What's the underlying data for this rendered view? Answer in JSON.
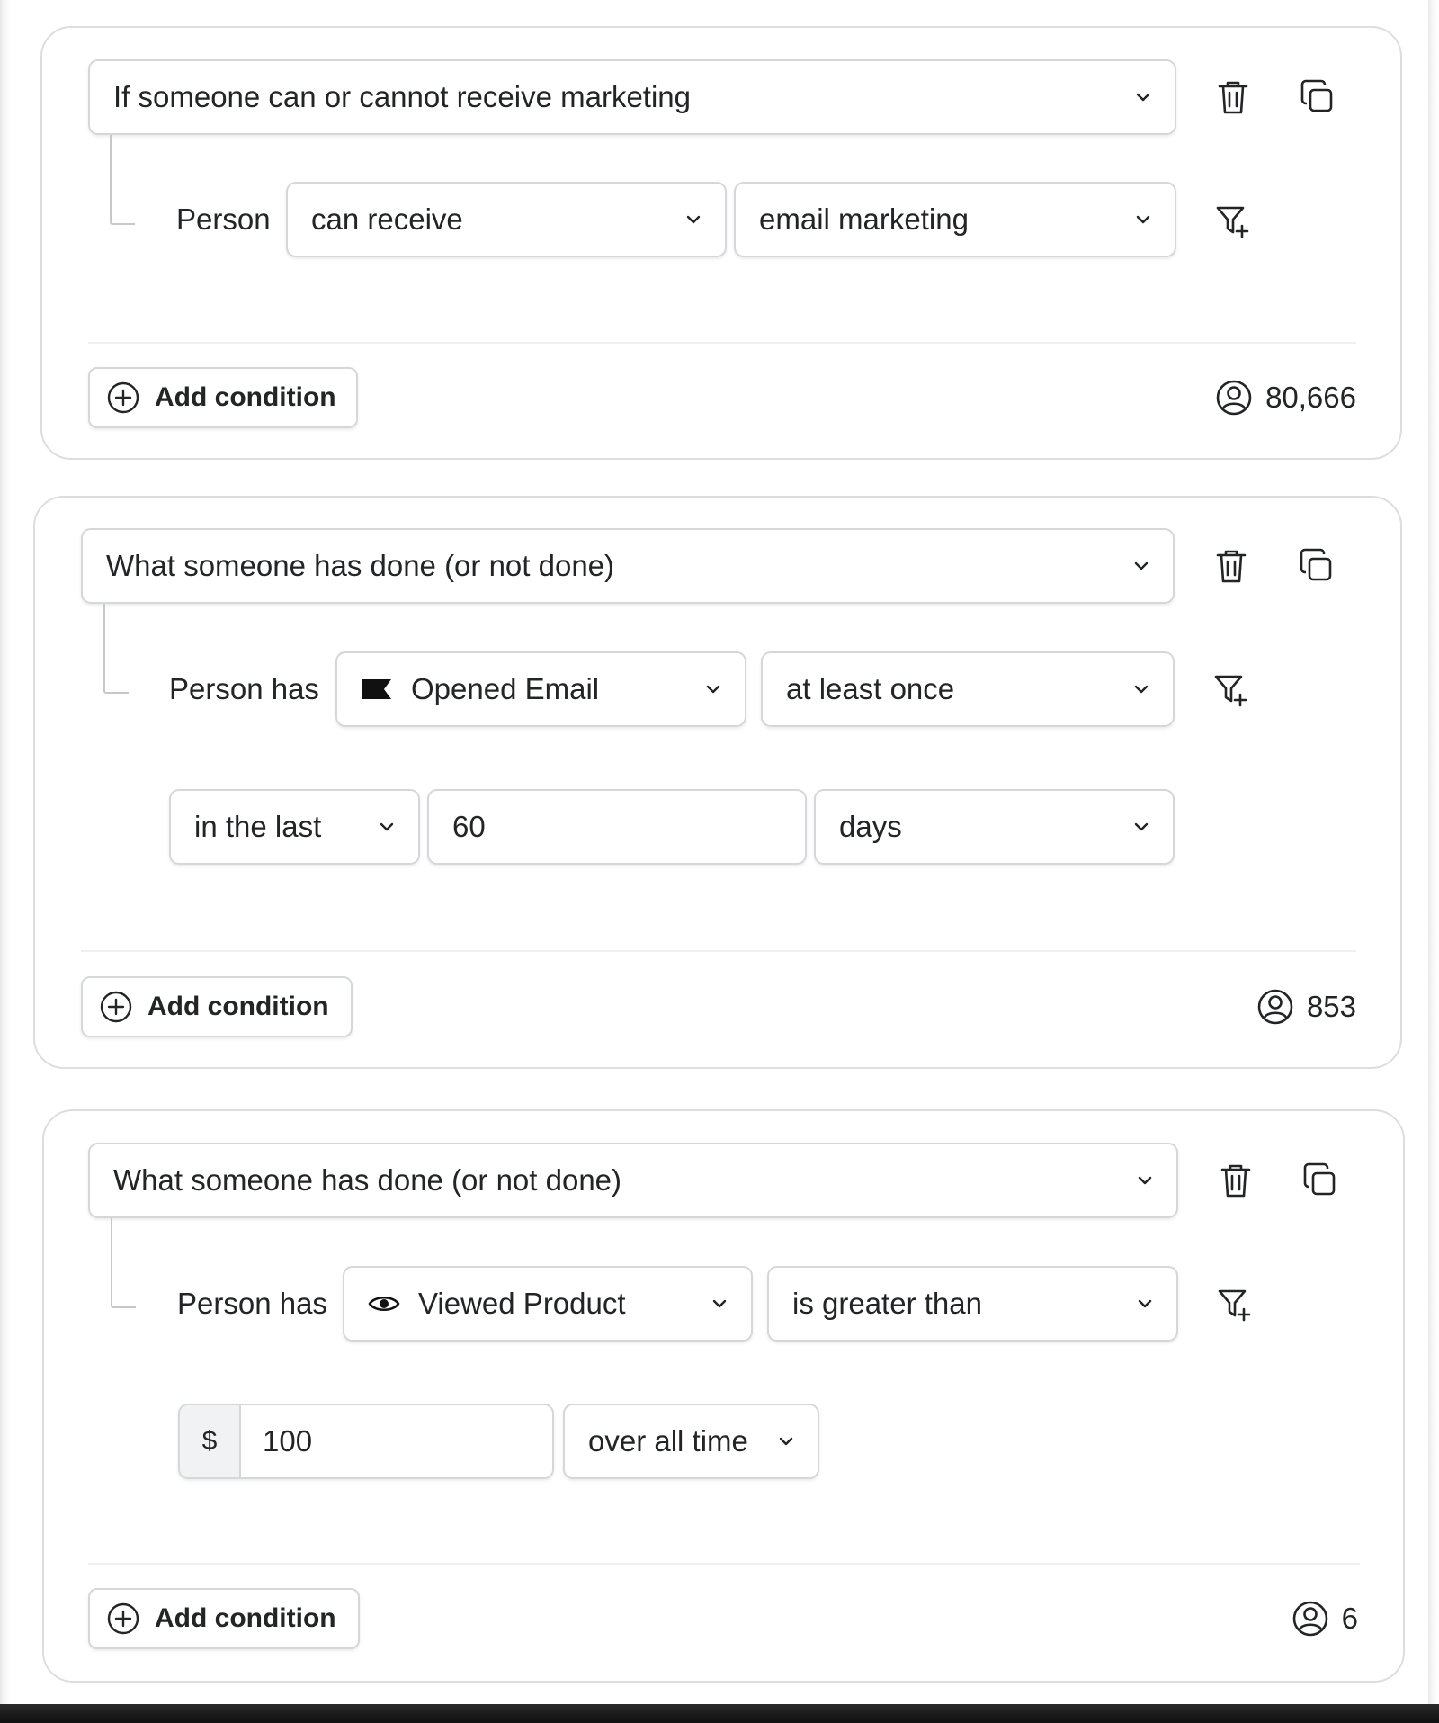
{
  "blocks": [
    {
      "type_label": "If someone can or cannot receive marketing",
      "subject_label": "Person",
      "select_1": "can receive",
      "select_2": "email marketing",
      "add_condition_label": "Add condition",
      "count": "80,666"
    },
    {
      "type_label": "What someone has done (or not done)",
      "subject_label": "Person has",
      "metric": {
        "label": "Opened Email",
        "icon": "flag-icon"
      },
      "frequency": "at least once",
      "timeframe": "in the last",
      "amount": "60",
      "unit": "days",
      "add_condition_label": "Add condition",
      "count": "853"
    },
    {
      "type_label": "What someone has done (or not done)",
      "subject_label": "Person has",
      "metric": {
        "label": "Viewed Product",
        "icon": "eye-icon"
      },
      "comparator": "is greater than",
      "currency_prefix": "$",
      "amount": "100",
      "timeframe": "over all time",
      "add_condition_label": "Add condition",
      "count": "6"
    }
  ],
  "colors": {
    "border": "#d6d7da",
    "text": "#232426",
    "tree_line": "#c7c8cc"
  }
}
